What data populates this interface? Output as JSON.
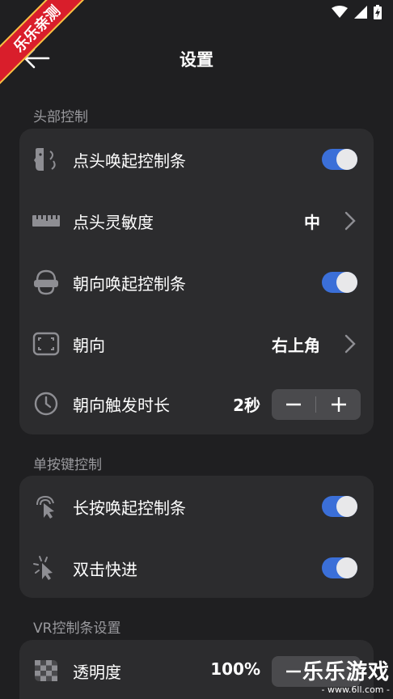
{
  "status": {
    "icons": [
      "wifi-icon",
      "signal-icon",
      "battery-icon"
    ]
  },
  "ribbon": "乐乐亲测",
  "header": {
    "title": "设置",
    "back_icon": "back-arrow-icon"
  },
  "sections": {
    "head_control": {
      "title": "头部控制",
      "rows": {
        "nod_wake": {
          "label": "点头唤起控制条",
          "icon": "nod-face-icon",
          "toggle": true
        },
        "nod_sensitivity": {
          "label": "点头灵敏度",
          "icon": "ruler-icon",
          "value": "中"
        },
        "orient_wake": {
          "label": "朝向唤起控制条",
          "icon": "vr-headset-icon",
          "toggle": true
        },
        "orientation": {
          "label": "朝向",
          "icon": "frame-corners-icon",
          "value": "右上角"
        },
        "orient_duration": {
          "label": "朝向触发时长",
          "icon": "clock-icon",
          "value": "2秒"
        }
      }
    },
    "single_key": {
      "title": "单按键控制",
      "rows": {
        "long_press": {
          "label": "长按唤起控制条",
          "icon": "tap-pointer-icon",
          "toggle": true
        },
        "double_tap": {
          "label": "双击快进",
          "icon": "click-burst-icon",
          "toggle": true
        }
      }
    },
    "vr_bar": {
      "title": "VR控制条设置",
      "rows": {
        "opacity": {
          "label": "透明度",
          "icon": "checkerboard-icon",
          "value": "100%"
        }
      }
    }
  },
  "watermark": {
    "main": "乐乐游戏",
    "sub": "- www.6ll.com -"
  },
  "colors": {
    "background": "#1f1f21",
    "card": "#2c2c2e",
    "accent": "#3b6fd8",
    "section_title": "#9a9a9e"
  }
}
